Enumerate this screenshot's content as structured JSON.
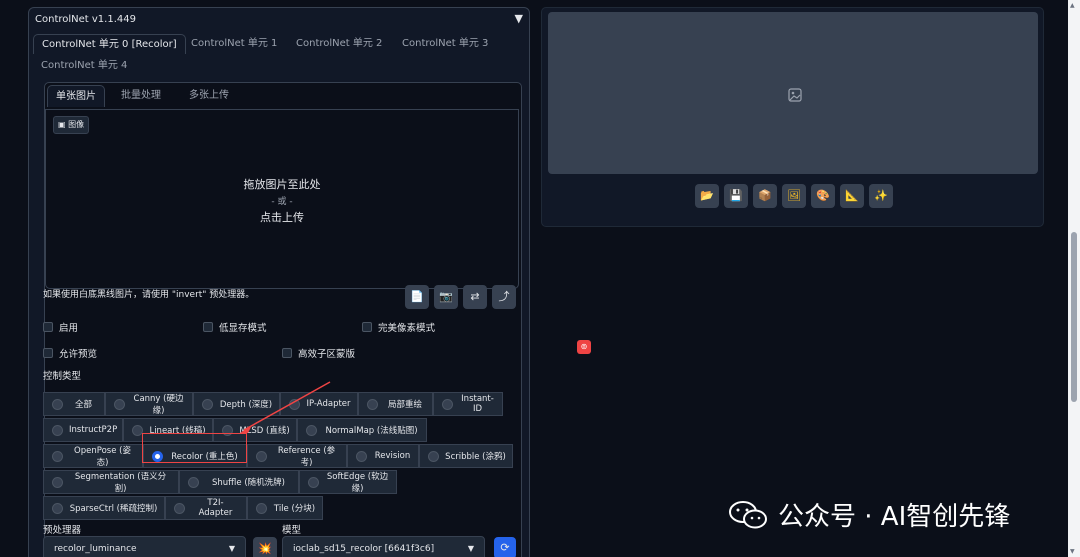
{
  "panel": {
    "title": "ControlNet v1.1.449",
    "collapse_icon": "▼"
  },
  "units": [
    "ControlNet 单元 0 [Recolor]",
    "ControlNet 单元 1",
    "ControlNet 单元 2",
    "ControlNet 单元 3",
    "ControlNet 单元 4"
  ],
  "input_tabs": [
    "单张图片",
    "批量处理",
    "多张上传"
  ],
  "drop": {
    "badge": "图像",
    "line1": "拖放图片至此处",
    "line2": "- 或 -",
    "line3": "点击上传"
  },
  "hint": "如果使用白底黑线图片，请使用 \"invert\" 预处理器。",
  "buttons": {
    "b1": "📄",
    "b2": "📷",
    "b3": "⇄",
    "b4": "⤴"
  },
  "checks": {
    "enable": "启用",
    "lowvram": "低显存模式",
    "pixel_perfect": "完美像素模式",
    "preview": "允许预览",
    "mask": "高效子区蒙版"
  },
  "control_type_label": "控制类型",
  "control_types": [
    "全部",
    "Canny (硬边缘)",
    "Depth (深度)",
    "IP-Adapter",
    "局部重绘",
    "Instant-ID",
    "InstructP2P",
    "Lineart (线稿)",
    "MLSD (直线)",
    "NormalMap (法线贴图)",
    "OpenPose (姿态)",
    "Recolor (重上色)",
    "Reference (参考)",
    "Revision",
    "Scribble (涂鸦)",
    "Segmentation (语义分割)",
    "Shuffle (随机洗牌)",
    "SoftEdge (软边缘)",
    "SparseCtrl (稀疏控制)",
    "T2I-Adapter",
    "Tile (分块)"
  ],
  "selected_control_type": "Recolor (重上色)",
  "preprocessor": {
    "label": "预处理器",
    "value": "recolor_luminance"
  },
  "model": {
    "label": "模型",
    "value": "ioclab_sd15_recolor [6641f3c6]"
  },
  "tools": [
    "📂",
    "💾",
    "📦",
    "🖼",
    "🎨",
    "📐",
    "✨"
  ],
  "watermark": "公众号 · AI智创先锋"
}
